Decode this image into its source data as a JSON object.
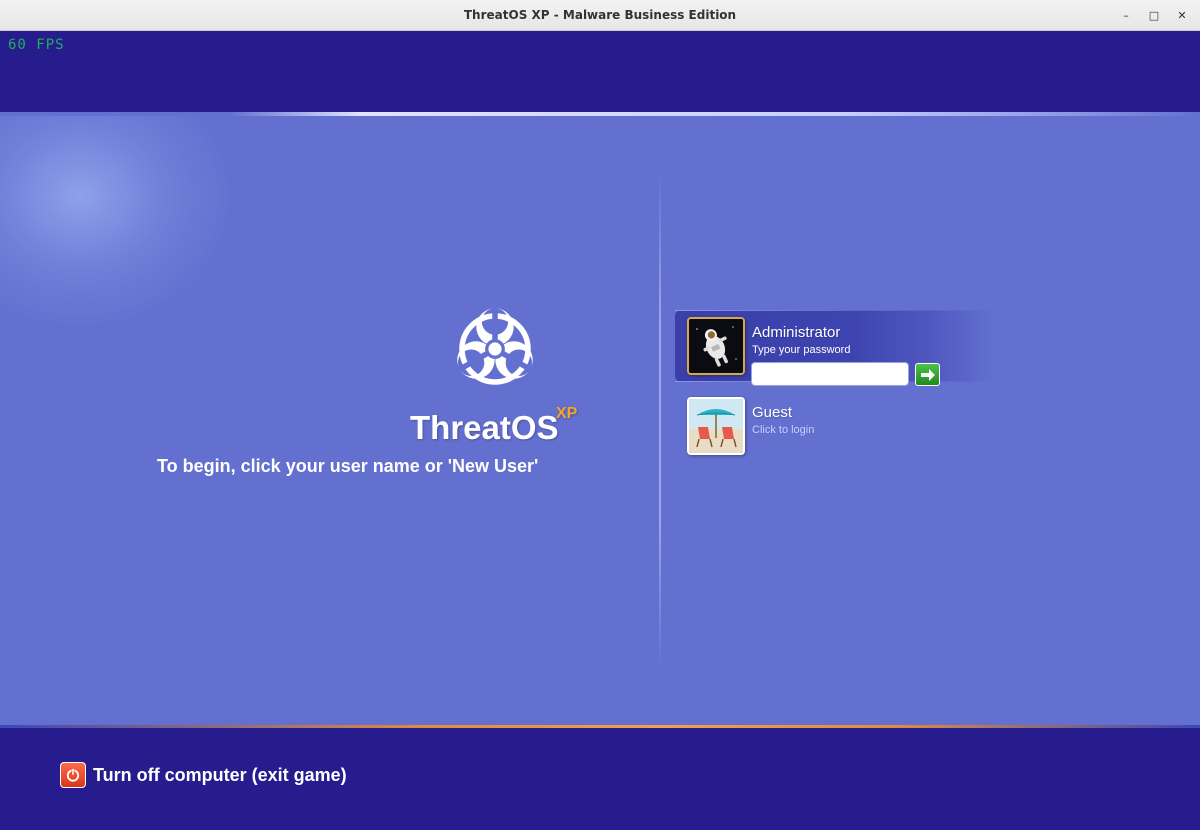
{
  "window": {
    "title": "ThreatOS XP - Malware Business Edition",
    "minimize_glyph": "–",
    "maximize_glyph": "□",
    "close_glyph": "✕"
  },
  "hud": {
    "fps": "60 FPS"
  },
  "branding": {
    "name": "ThreatOS",
    "superscript": "XP",
    "logo_icon": "biohazard-icon",
    "instruction": "To begin, click your user name or 'New User'"
  },
  "users": [
    {
      "name": "Administrator",
      "hint": "Type your password",
      "avatar_icon": "astronaut-avatar",
      "password_value": ""
    },
    {
      "name": "Guest",
      "hint": "Click to login",
      "avatar_icon": "beach-chairs-avatar"
    }
  ],
  "power": {
    "label": "Turn off computer (exit game)",
    "icon": "power-icon"
  },
  "colors": {
    "accent_blue": "#6370d0",
    "band_dark": "#261c8e",
    "orange_accent": "#f5a623",
    "fps_green": "#1fae5c",
    "go_green": "#2aa52a",
    "power_red": "#e8452a"
  }
}
